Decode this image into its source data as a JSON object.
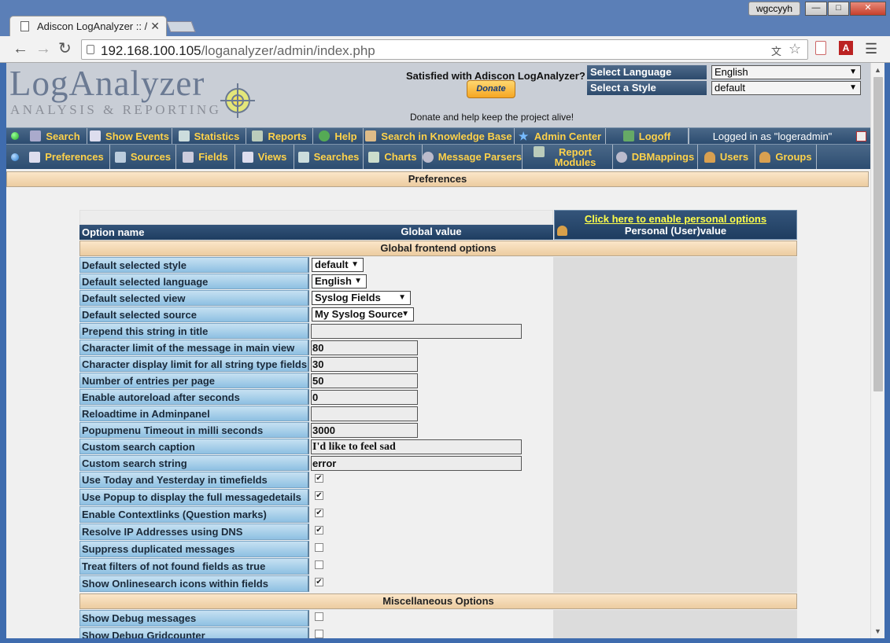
{
  "window": {
    "user_chip": "wgccyyh",
    "tab_title": "Adiscon LogAnalyzer :: /",
    "url_host": "192.168.100.105",
    "url_path": "/loganalyzer/admin/index.php"
  },
  "header": {
    "logo_main": "LogAnalyzer",
    "logo_sub": "ANALYSIS & REPORTING",
    "satisfied": "Satisfied with Adiscon LogAnalyzer?",
    "donate_label": "Donate",
    "donate_text": "Donate and help keep the project alive!",
    "language_label": "Select Language",
    "language_value": "English",
    "style_label": "Select a Style",
    "style_value": "default"
  },
  "menu1": {
    "items": [
      "Search",
      "Show Events",
      "Statistics",
      "Reports",
      "Help",
      "Search in Knowledge Base",
      "Admin Center",
      "Logoff"
    ],
    "logged_in": "Logged in as \"logeradmin\""
  },
  "menu2": {
    "items": [
      "Preferences",
      "Sources",
      "Fields",
      "Views",
      "Searches",
      "Charts",
      "Message Parsers",
      "Report Modules",
      "DBMappings",
      "Users",
      "Groups"
    ]
  },
  "page_title": "Preferences",
  "table": {
    "col_name": "Option name",
    "col_global": "Global value",
    "personal_link": "Click here to enable personal options",
    "col_personal": "Personal (User)value",
    "section1": "Global frontend options",
    "section2": "Miscellaneous Options",
    "rows": [
      {
        "label": "Default selected style",
        "value": "default"
      },
      {
        "label": "Default selected language",
        "value": "English"
      },
      {
        "label": "Default selected view",
        "value": "Syslog Fields"
      },
      {
        "label": "Default selected source",
        "value": "My Syslog Source"
      },
      {
        "label": "Prepend this string in title",
        "value": ""
      },
      {
        "label": "Character limit of the message in main view",
        "value": "80"
      },
      {
        "label": "Character display limit for all string type fields",
        "value": "30"
      },
      {
        "label": "Number of entries per page",
        "value": "50"
      },
      {
        "label": "Enable autoreload after seconds",
        "value": "0"
      },
      {
        "label": "Reloadtime in Adminpanel",
        "value": ""
      },
      {
        "label": "Popupmenu Timeout in milli seconds",
        "value": "3000"
      },
      {
        "label": "Custom search caption",
        "value": "I'd like to feel sad"
      },
      {
        "label": "Custom search string",
        "value": "error"
      },
      {
        "label": "Use Today and Yesterday in timefields",
        "checked": true
      },
      {
        "label": "Use Popup to display the full messagedetails",
        "checked": true
      },
      {
        "label": "Enable Contextlinks (Question marks)",
        "checked": true
      },
      {
        "label": "Resolve IP Addresses using DNS",
        "checked": true
      },
      {
        "label": "Suppress duplicated messages",
        "checked": false
      },
      {
        "label": "Treat filters of not found fields as true",
        "checked": false
      },
      {
        "label": "Show Onlinesearch icons within fields",
        "checked": true
      }
    ],
    "misc_rows": [
      {
        "label": "Show Debug messages",
        "checked": false
      },
      {
        "label": "Show Debug Gridcounter",
        "checked": false
      }
    ]
  },
  "colors": {
    "menu_text": "#ffd24a",
    "menu_bg": "#2c4c70",
    "label_bg": "#8ec0e2",
    "section_bg": "#eccca0"
  }
}
